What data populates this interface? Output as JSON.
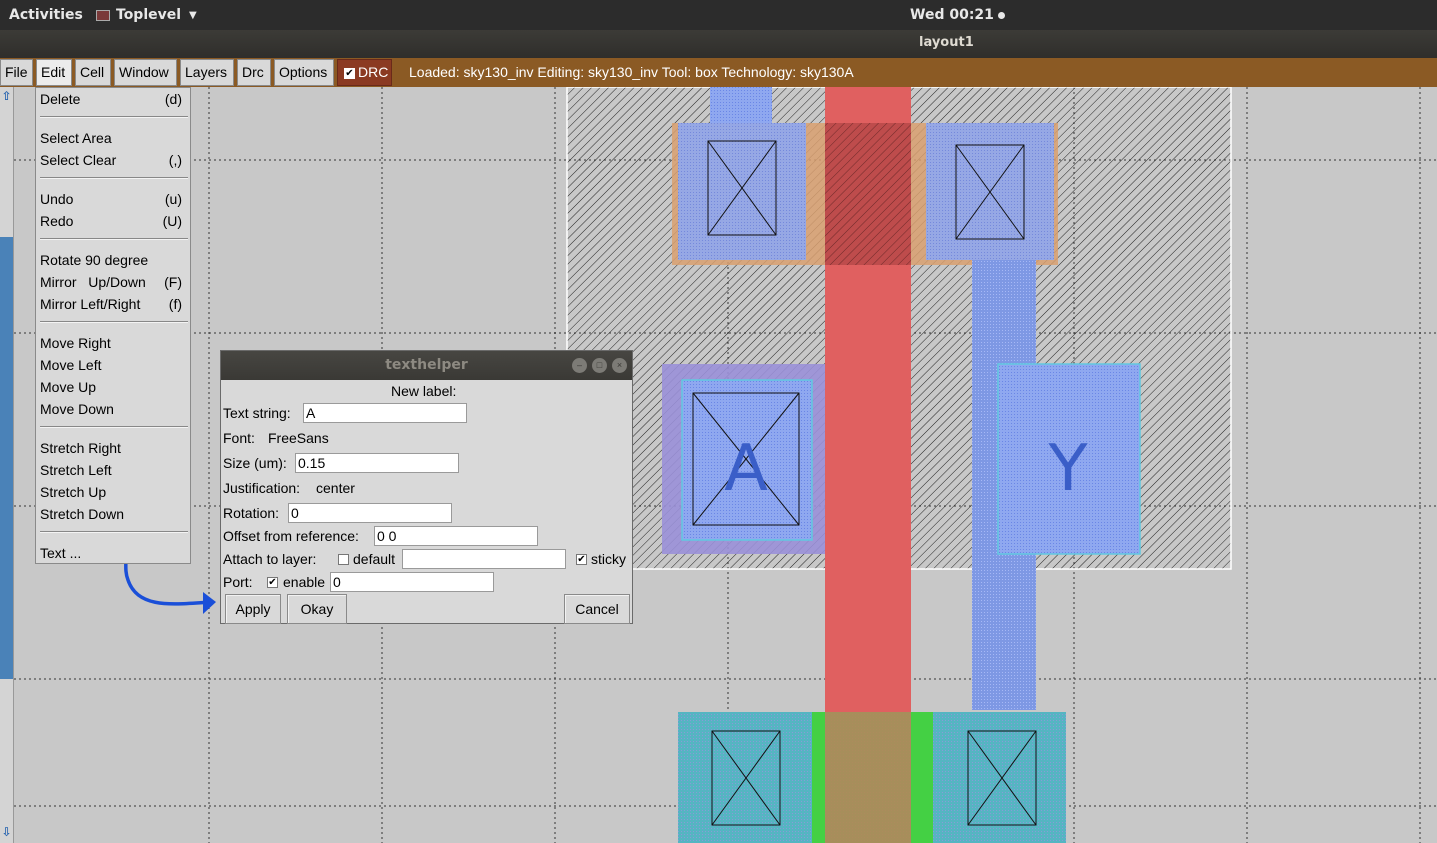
{
  "topbar": {
    "activities": "Activities",
    "app_name": "Toplevel",
    "clock": "Wed 00:21"
  },
  "window": {
    "title": "layout1"
  },
  "menubar": {
    "items": [
      "File",
      "Edit",
      "Cell",
      "Window",
      "Layers",
      "Drc",
      "Options"
    ],
    "drc_toggle_label": "DRC",
    "drc_checked": true,
    "status": "Loaded: sky130_inv Editing: sky130_inv Tool: box  Technology: sky130A"
  },
  "edit_menu": {
    "items": [
      {
        "label": "Delete",
        "accel": "(d)"
      },
      {
        "label": "Select Area",
        "accel": ""
      },
      {
        "label": "Select Clear",
        "accel": "(,)"
      },
      {
        "label": "Undo",
        "accel": "(u)"
      },
      {
        "label": "Redo",
        "accel": "(U)"
      },
      {
        "label": "Rotate 90 degree",
        "accel": ""
      },
      {
        "label": "Mirror   Up/Down",
        "accel": "(F)"
      },
      {
        "label": "Mirror Left/Right",
        "accel": "(f)"
      },
      {
        "label": "Move Right",
        "accel": ""
      },
      {
        "label": "Move Left",
        "accel": ""
      },
      {
        "label": "Move Up",
        "accel": ""
      },
      {
        "label": "Move Down",
        "accel": ""
      },
      {
        "label": "Stretch Right",
        "accel": ""
      },
      {
        "label": "Stretch Left",
        "accel": ""
      },
      {
        "label": "Stretch Up",
        "accel": ""
      },
      {
        "label": "Stretch Down",
        "accel": ""
      },
      {
        "label": "Text ...",
        "accel": ""
      }
    ]
  },
  "layout": {
    "label_a": "A",
    "label_y": "Y"
  },
  "dialog": {
    "title": "texthelper",
    "heading": "New label:",
    "text_string_label": "Text string:",
    "text_string_value": "A",
    "font_label": "Font:",
    "font_value": "FreeSans",
    "size_label": "Size (um):",
    "size_value": "0.15",
    "justification_label": "Justification:",
    "justification_value": "center",
    "rotation_label": "Rotation:",
    "rotation_value": "0",
    "offset_label": "Offset from reference:",
    "offset_value": "0 0",
    "attach_label": "Attach to layer:",
    "attach_default_label": "default",
    "attach_default_checked": false,
    "attach_value": "",
    "sticky_label": "sticky",
    "sticky_checked": true,
    "port_label": "Port:",
    "port_enable_label": "enable",
    "port_enable_checked": true,
    "port_value": "0",
    "apply_label": "Apply",
    "okay_label": "Okay",
    "cancel_label": "Cancel"
  },
  "colors": {
    "menubar_bg": "#8b5a24",
    "poly": "#e06060",
    "metal_blue": "#8fa8f0",
    "diffusion_green": "#44d044",
    "pwell_cyan": "#5ab8c8",
    "annotation_arrow": "#1a4fd8"
  }
}
